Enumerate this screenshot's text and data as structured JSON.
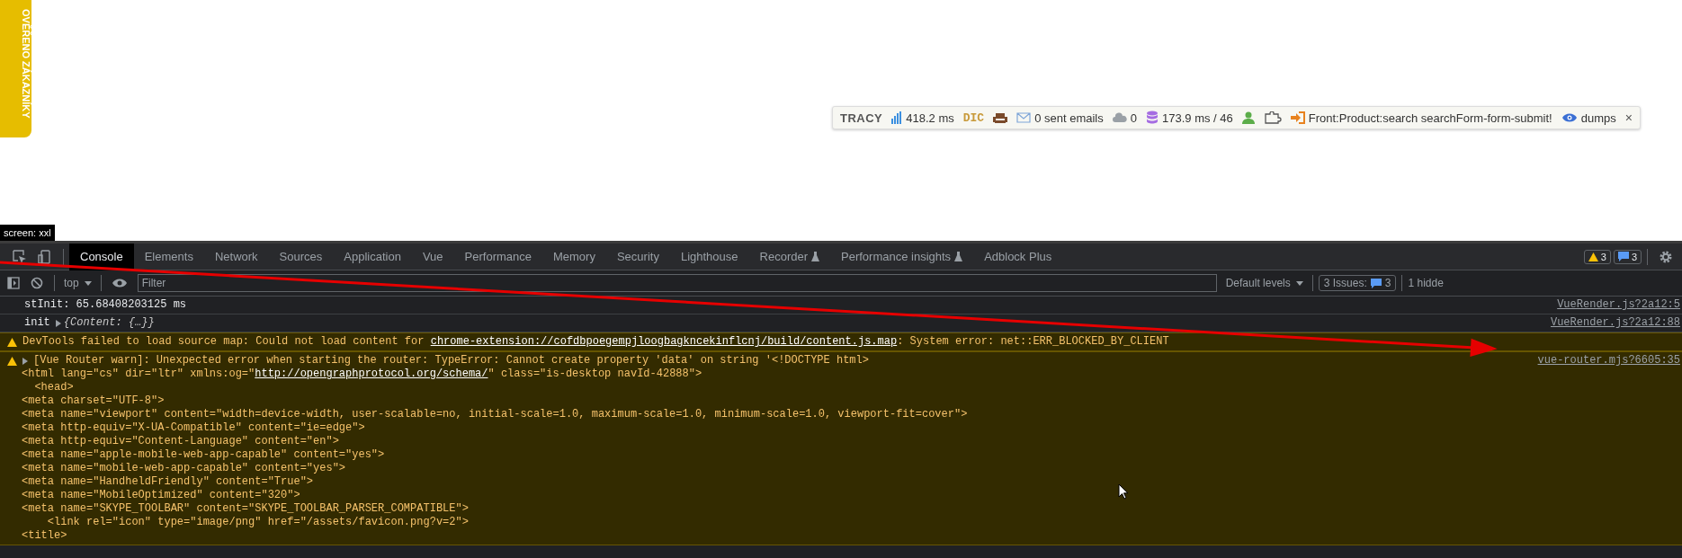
{
  "badge": {
    "text": "OVĚŘENO ZÁKAZNÍKY"
  },
  "tracy_bar": {
    "items": [
      {
        "kind": "logo",
        "text": "TRACY"
      },
      {
        "kind": "chart",
        "text": "418.2 ms"
      },
      {
        "kind": "dic",
        "text": "DIC"
      },
      {
        "kind": "armchair"
      },
      {
        "kind": "mail",
        "text": "0 sent emails"
      },
      {
        "kind": "cloud",
        "text": "0"
      },
      {
        "kind": "database",
        "text": "173.9 ms / 46"
      },
      {
        "kind": "user"
      },
      {
        "kind": "puzzle"
      },
      {
        "kind": "signin",
        "text": "Front:Product:search searchForm-form-submit!"
      },
      {
        "kind": "eye",
        "text": "dumps"
      },
      {
        "kind": "close",
        "text": "×"
      }
    ]
  },
  "screen_label": "screen: xxl",
  "devtools": {
    "tabs": [
      {
        "label": "Console",
        "selected": true,
        "experimental": false
      },
      {
        "label": "Elements",
        "selected": false,
        "experimental": false
      },
      {
        "label": "Network",
        "selected": false,
        "experimental": false
      },
      {
        "label": "Sources",
        "selected": false,
        "experimental": false
      },
      {
        "label": "Application",
        "selected": false,
        "experimental": false
      },
      {
        "label": "Vue",
        "selected": false,
        "experimental": false
      },
      {
        "label": "Performance",
        "selected": false,
        "experimental": false
      },
      {
        "label": "Memory",
        "selected": false,
        "experimental": false
      },
      {
        "label": "Security",
        "selected": false,
        "experimental": false
      },
      {
        "label": "Lighthouse",
        "selected": false,
        "experimental": false
      },
      {
        "label": "Recorder",
        "selected": false,
        "experimental": true
      },
      {
        "label": "Performance insights",
        "selected": false,
        "experimental": true
      },
      {
        "label": "Adblock Plus",
        "selected": false,
        "experimental": false
      }
    ],
    "warnings_count": "3",
    "messages_count": "3",
    "toolbar": {
      "context": "top",
      "filter_placeholder": "Filter",
      "levels": "Default levels",
      "issues_label": "3 Issues:",
      "issues_count": "3",
      "hidden_label": "1 hidde"
    },
    "console": [
      {
        "kind": "log",
        "lines": [
          {
            "text": "stInit: 65.68408203125 ms"
          }
        ],
        "source": "VueRender.js?2a12:5"
      },
      {
        "kind": "object",
        "label": "init",
        "value": "{Content: {…}}",
        "source": "VueRender.js?2a12:88"
      },
      {
        "kind": "warning",
        "expandable": false,
        "lines": [
          {
            "text": "DevTools failed to load source map: Could not load content for ",
            "link": "chrome-extension://cofdbpoegempjloogbagkncekinflcnj/build/content.js.map",
            "after": ": System error: net::ERR_BLOCKED_BY_CLIENT"
          }
        ]
      },
      {
        "kind": "warning",
        "expandable": true,
        "source": "vue-router.mjs?6605:35",
        "lines": [
          {
            "text": "[Vue Router warn]: Unexpected error when starting the router: TypeError: Cannot create property 'data' on string '<!DOCTYPE html>"
          },
          {
            "text": "<html lang=\"cs\" dir=\"ltr\" xmlns:og=\"",
            "link": "http://opengraphprotocol.org/schema/",
            "after": "\" class=\"is-desktop navId-42888\">"
          },
          {
            "text": "  <head>"
          },
          {
            "text": "<meta charset=\"UTF-8\">"
          },
          {
            "text": "<meta name=\"viewport\" content=\"width=device-width, user-scalable=no, initial-scale=1.0, maximum-scale=1.0, minimum-scale=1.0, viewport-fit=cover\">"
          },
          {
            "text": "<meta http-equiv=\"X-UA-Compatible\" content=\"ie=edge\">"
          },
          {
            "text": "<meta http-equiv=\"Content-Language\" content=\"en\">"
          },
          {
            "text": "<meta name=\"apple-mobile-web-app-capable\" content=\"yes\">"
          },
          {
            "text": "<meta name=\"mobile-web-app-capable\" content=\"yes\">"
          },
          {
            "text": "<meta name=\"HandheldFriendly\" content=\"True\">"
          },
          {
            "text": "<meta name=\"MobileOptimized\" content=\"320\">"
          },
          {
            "text": "<meta name=\"SKYPE_TOOLBAR\" content=\"SKYPE_TOOLBAR_PARSER_COMPATIBLE\">"
          },
          {
            "text": "    <link rel=\"icon\" type=\"image/png\" href=\"/assets/favicon.png?v=2\">"
          },
          {
            "text": "<title>"
          }
        ]
      }
    ]
  }
}
